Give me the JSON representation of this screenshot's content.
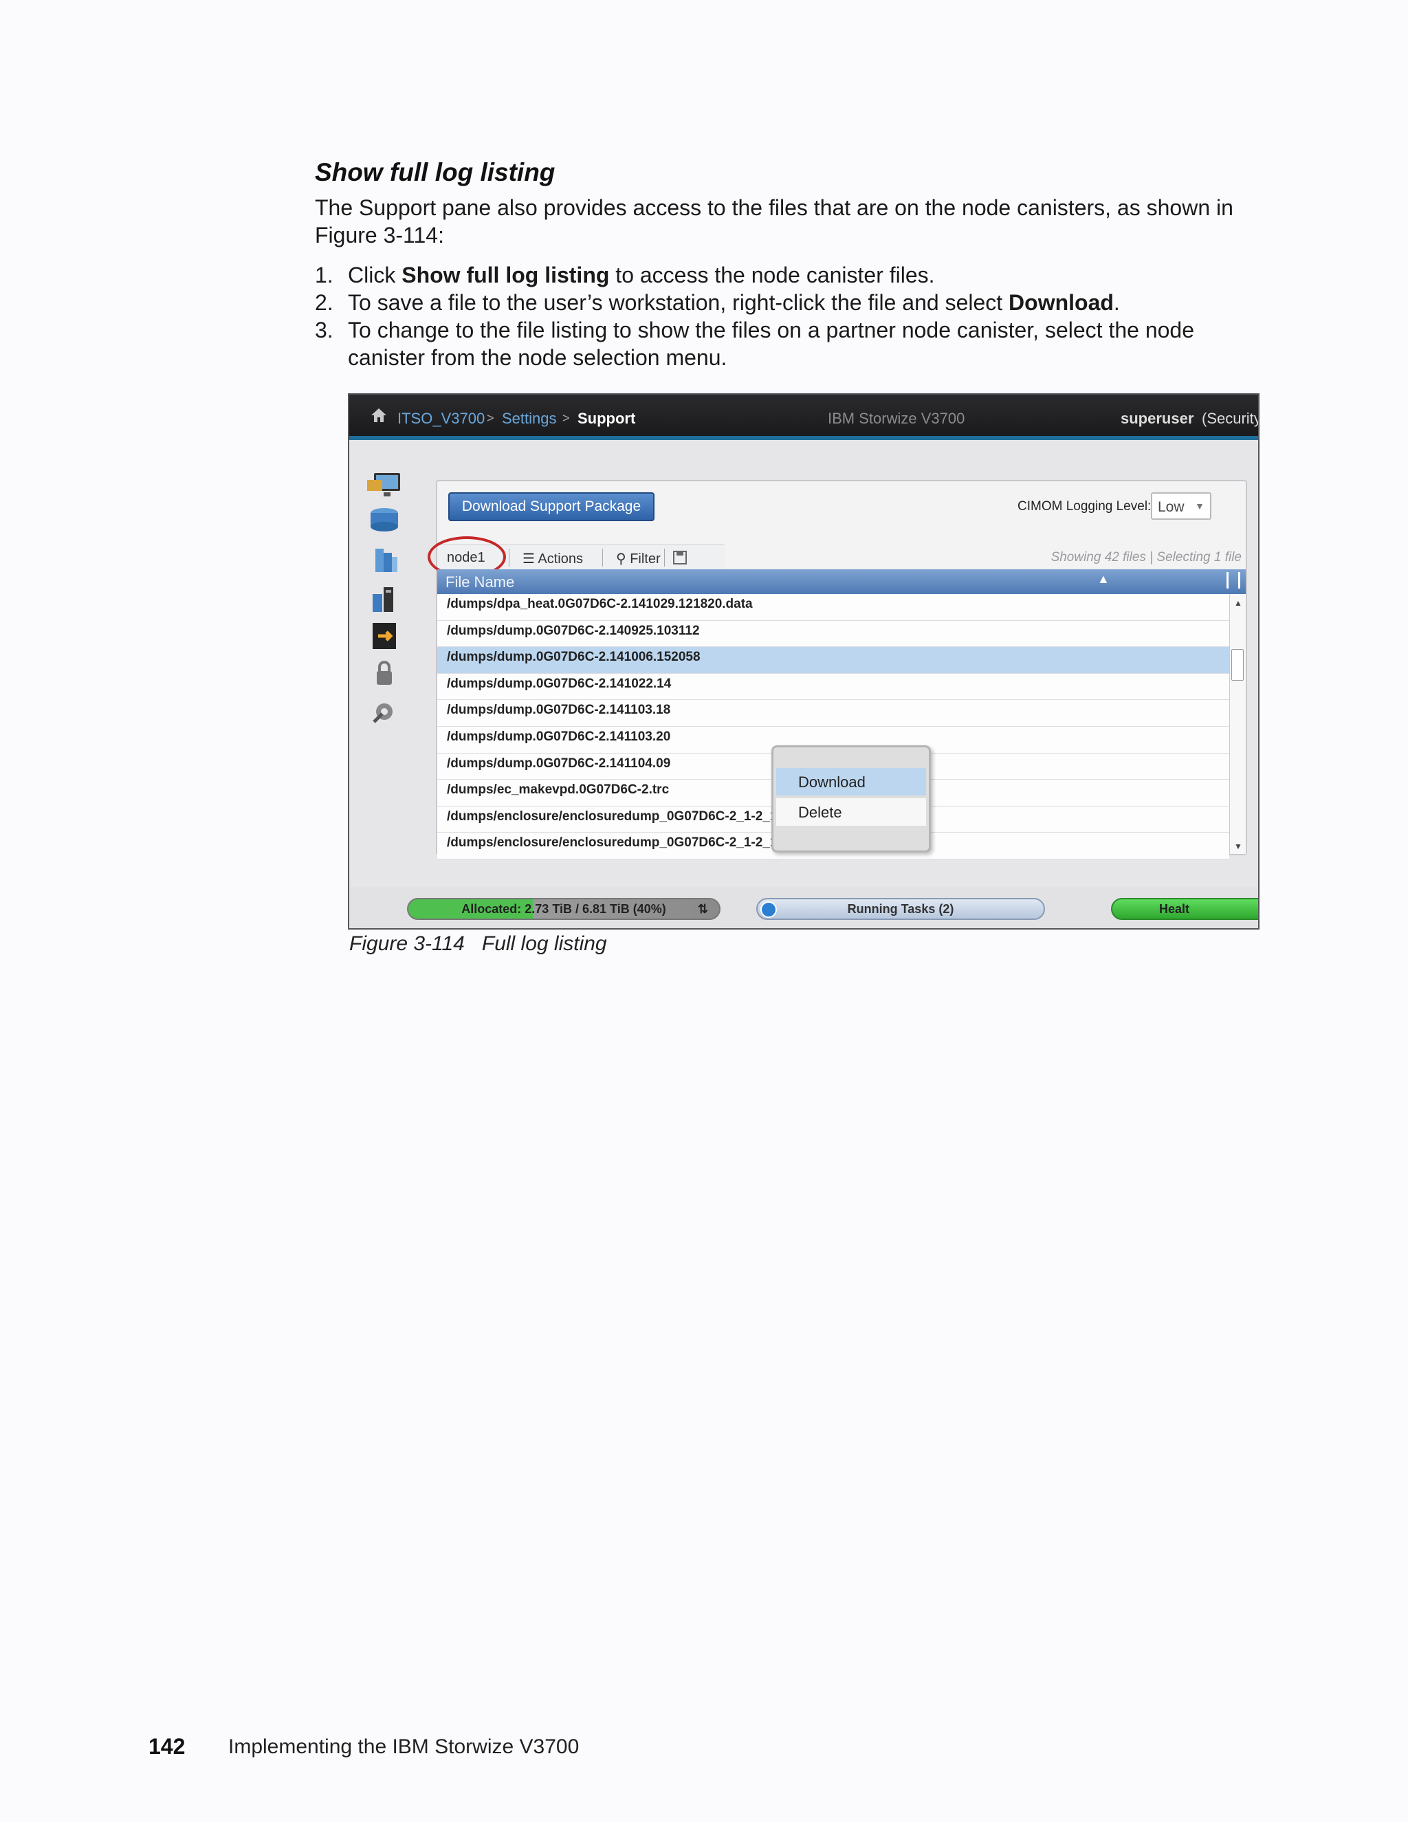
{
  "heading": "Show full log listing",
  "intro": "The Support pane also provides access to the files that are on the node canisters, as shown in Figure 3-114:",
  "steps": [
    {
      "num": "1.",
      "pre": "Click ",
      "bold": "Show full log listing",
      "post": " to access the node canister files."
    },
    {
      "num": "2.",
      "pre": "To save a file to the user’s workstation, right-click the file and select ",
      "bold": "Download",
      "post": "."
    },
    {
      "num": "3.",
      "pre": "To change to the file listing to show the files on a partner node canister, select the node canister from the node selection menu.",
      "bold": "",
      "post": ""
    }
  ],
  "screenshot": {
    "breadcrumb": [
      "ITSO_V3700",
      "Settings",
      "Support"
    ],
    "breadcrumb_sep": ">",
    "product": "IBM Storwize V3700",
    "user": "superuser",
    "role": "(Security",
    "download_button": "Download Support Package",
    "cimom_label": "CIMOM Logging Level:",
    "cimom_value": "Low",
    "toolbar": {
      "node": "node1",
      "actions": "Actions",
      "filter": "Filter"
    },
    "showing": "Showing 42 files | Selecting 1 file",
    "column_header": "File Name",
    "files": [
      "/dumps/dpa_heat.0G07D6C-2.141029.121820.data",
      "/dumps/dump.0G07D6C-2.140925.103112",
      "/dumps/dump.0G07D6C-2.141006.152058",
      "/dumps/dump.0G07D6C-2.141022.14",
      "/dumps/dump.0G07D6C-2.141103.18",
      "/dumps/dump.0G07D6C-2.141103.20",
      "/dumps/dump.0G07D6C-2.141104.09",
      "/dumps/ec_makevpd.0G07D6C-2.trc",
      "/dumps/enclosure/enclosuredump_0G07D6C-2_1-2_140909_152716",
      "/dumps/enclosure/enclosuredump_0G07D6C-2_1-2_140910_162011"
    ],
    "selected_index": 2,
    "context_menu": {
      "download": "Download",
      "delete": "Delete"
    },
    "status": {
      "allocated": "Allocated: 2.73 TiB / 6.81 TiB (40%)",
      "allocated_fraction": 0.4,
      "tasks": "Running Tasks (2)",
      "health": "Healt"
    },
    "colors": {
      "accent": "#1e6f9a",
      "selection": "#bcd6ef",
      "header": "#4e78b3",
      "circle": "#c62828"
    }
  },
  "caption": "Figure 3-114   Full log listing",
  "footer": {
    "page_number": "142",
    "book_title": "Implementing the IBM Storwize V3700"
  }
}
